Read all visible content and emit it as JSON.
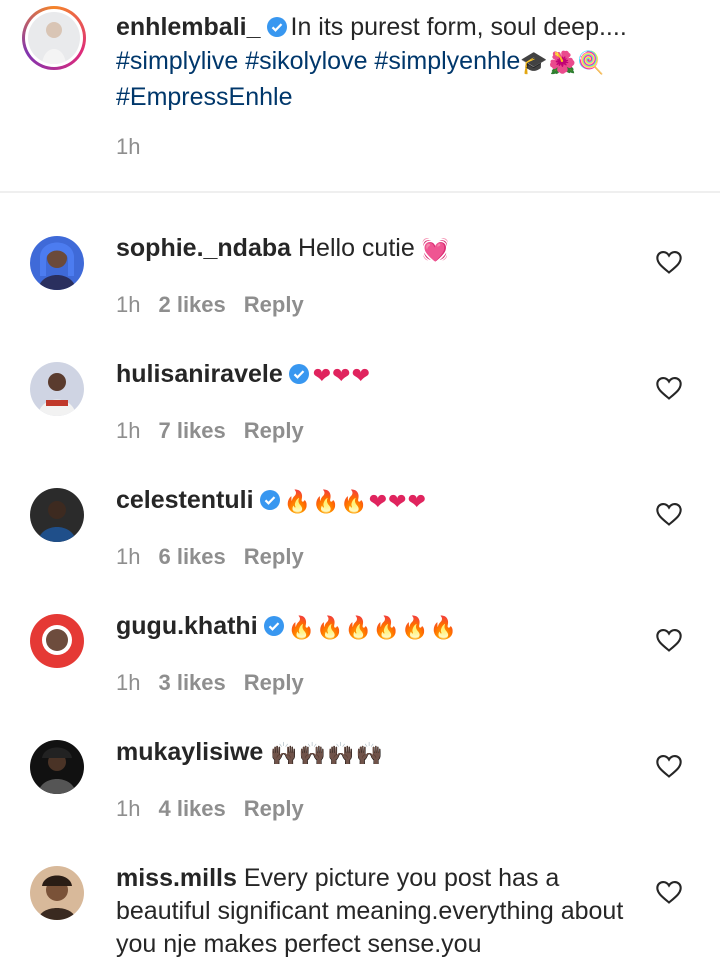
{
  "caption": {
    "username": "enhlembali_",
    "text": "In its purest form, soul deep....",
    "tags_line1": "#simplylive #sikolylove #simplyenhle",
    "tags_emoji": "🎓🌺🍭",
    "tags_line2": "#EmpressEnhle",
    "time": "1h"
  },
  "comments": [
    {
      "username": "sophie._ndaba",
      "text": "Hello cutie",
      "emoji": "💓",
      "time": "1h",
      "likes": "2 likes",
      "reply": "Reply"
    },
    {
      "username": "hulisaniravele",
      "text": "",
      "emoji": "❤❤❤",
      "time": "1h",
      "likes": "7 likes",
      "reply": "Reply"
    },
    {
      "username": "celestentuli",
      "text": "",
      "emoji": "🔥🔥🔥❤❤❤",
      "time": "1h",
      "likes": "6 likes",
      "reply": "Reply"
    },
    {
      "username": "gugu.khathi",
      "text": "",
      "emoji": "🔥🔥🔥🔥🔥🔥",
      "time": "1h",
      "likes": "3 likes",
      "reply": "Reply"
    },
    {
      "username": "mukaylisiwe",
      "text": "",
      "emoji": "🙌🏿🙌🏿🙌🏿🙌🏿",
      "time": "1h",
      "likes": "4 likes",
      "reply": "Reply"
    },
    {
      "username": "miss.mills",
      "text": "Every picture you post has a beautiful significant meaning.everything about you nje makes perfect sense.you"
    }
  ],
  "colors": {
    "verified": "#3897f0",
    "tag": "#00376b",
    "meta": "#8e8e8e",
    "heart_red": "#e0245e"
  },
  "icons": {
    "verified": "verified-badge-icon",
    "like": "heart-outline-icon"
  }
}
